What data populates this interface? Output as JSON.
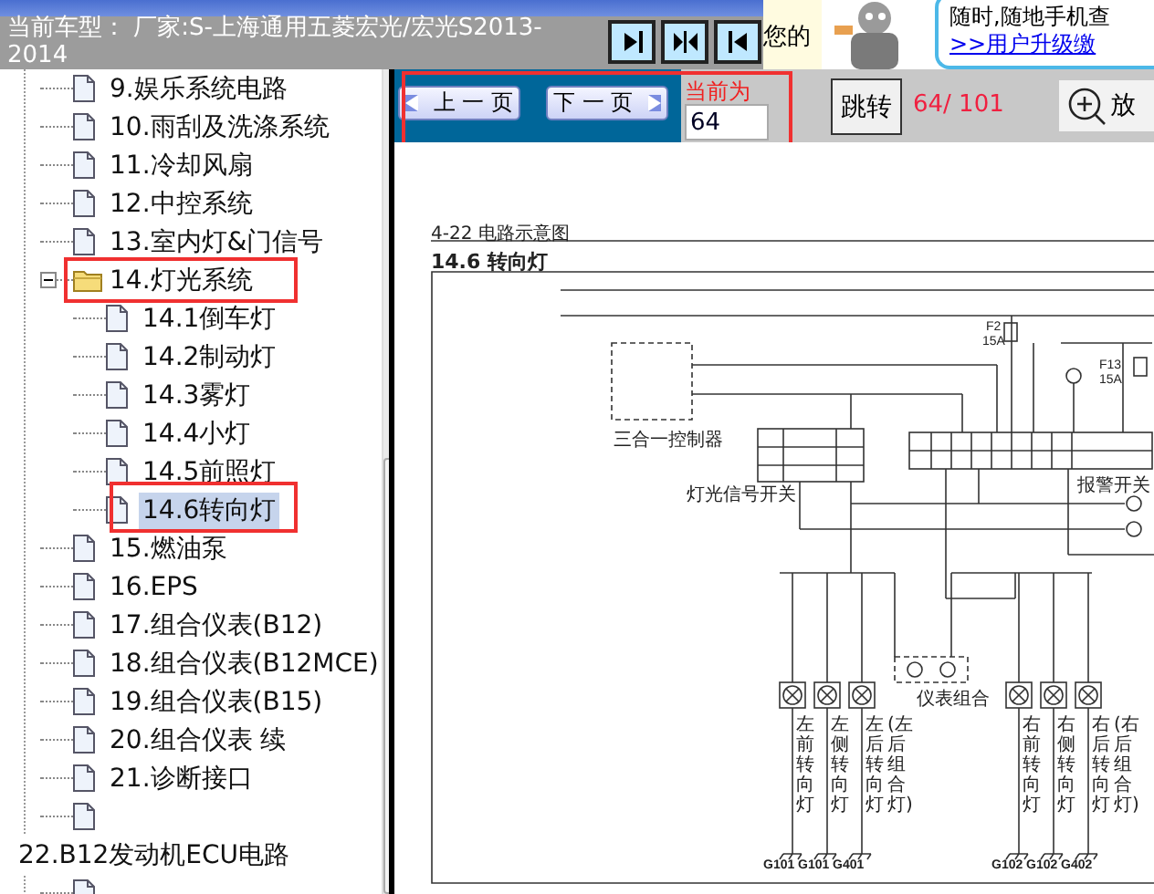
{
  "header": {
    "car_model": "当前车型： 厂家:S-上海通用五菱宏光/宏光S2013-2014",
    "view_buttons": [
      {
        "kind": "right"
      },
      {
        "kind": "inward"
      },
      {
        "kind": "left"
      }
    ],
    "notice": "您的",
    "ad": {
      "line": "随时,随地手机查",
      "link": ">>用户升级缴"
    }
  },
  "tree": [
    {
      "label": "9.娱乐系统电路",
      "kind": "page",
      "selected": false,
      "outlined": false
    },
    {
      "label": "10.雨刮及洗涤系统",
      "kind": "page",
      "selected": false,
      "outlined": false
    },
    {
      "label": "11.冷却风扇",
      "kind": "page",
      "selected": false,
      "outlined": false
    },
    {
      "label": "12.中控系统",
      "kind": "page",
      "selected": false,
      "outlined": false
    },
    {
      "label": "13.室内灯&门信号",
      "kind": "page",
      "selected": false,
      "outlined": false
    },
    {
      "label": "14.灯光系统",
      "kind": "folder",
      "expanded": true,
      "selected": false,
      "outlined": true,
      "children": [
        {
          "label": "14.1倒车灯",
          "kind": "page",
          "selected": false,
          "outlined": false
        },
        {
          "label": "14.2制动灯",
          "kind": "page",
          "selected": false,
          "outlined": false
        },
        {
          "label": "14.3雾灯",
          "kind": "page",
          "selected": false,
          "outlined": false
        },
        {
          "label": "14.4小灯",
          "kind": "page",
          "selected": false,
          "outlined": false
        },
        {
          "label": "14.5前照灯",
          "kind": "page",
          "selected": false,
          "outlined": false
        },
        {
          "label": "14.6转向灯",
          "kind": "page",
          "selected": true,
          "outlined": true
        }
      ]
    },
    {
      "label": "15.燃油泵",
      "kind": "page",
      "selected": false,
      "outlined": false
    },
    {
      "label": "16.EPS",
      "kind": "page",
      "selected": false,
      "outlined": false
    },
    {
      "label": "17.组合仪表(B12)",
      "kind": "page",
      "selected": false,
      "outlined": false
    },
    {
      "label": "18.组合仪表(B12MCE)",
      "kind": "page",
      "selected": false,
      "outlined": false
    },
    {
      "label": "19.组合仪表(B15)",
      "kind": "page",
      "selected": false,
      "outlined": false
    },
    {
      "label": "20.组合仪表 续",
      "kind": "page",
      "selected": false,
      "outlined": false
    },
    {
      "label": "21.诊断接口",
      "kind": "page",
      "selected": false,
      "outlined": false
    },
    {
      "kind": "page",
      "selected": false,
      "outlined": false
    },
    {
      "label": "22.B12发动机ECU电路",
      "kind": "chapter",
      "selected": false,
      "outlined": false,
      "children": [
        {
          "kind": "page",
          "selected": false,
          "outlined": false
        }
      ]
    }
  ],
  "toolbar": {
    "outlined": true,
    "prev": "上 一 页",
    "next": "下 一 页",
    "page_label": "当前为",
    "page_value": "64",
    "go": "跳转",
    "page_count": "64/ 101",
    "zoom": "放"
  },
  "diagram": {
    "header": "4-22 电路示意图",
    "title": "14.6 转向灯",
    "labels": [
      {
        "text": "三合一控制器",
        "kind": "part"
      },
      {
        "text": "灯光信号开关",
        "kind": "part"
      },
      {
        "text": "报警开关",
        "kind": "part"
      },
      {
        "text": "仪表组合",
        "kind": "part"
      },
      {
        "text": "F2",
        "kind": "fuse"
      },
      {
        "text": "15A",
        "kind": "fuse"
      },
      {
        "text": "F13",
        "kind": "fuse"
      },
      {
        "text": "15A",
        "kind": "fuse"
      }
    ],
    "lamps": [
      "左前转向灯",
      "左侧转向灯",
      "左后转向灯",
      "(左后组合灯)",
      "右前转向灯",
      "右侧转向灯",
      "右后转向灯",
      "(右后组合灯)"
    ],
    "grounds": [
      "G101",
      "G101",
      "G401",
      "G102",
      "G102",
      "G402"
    ]
  }
}
